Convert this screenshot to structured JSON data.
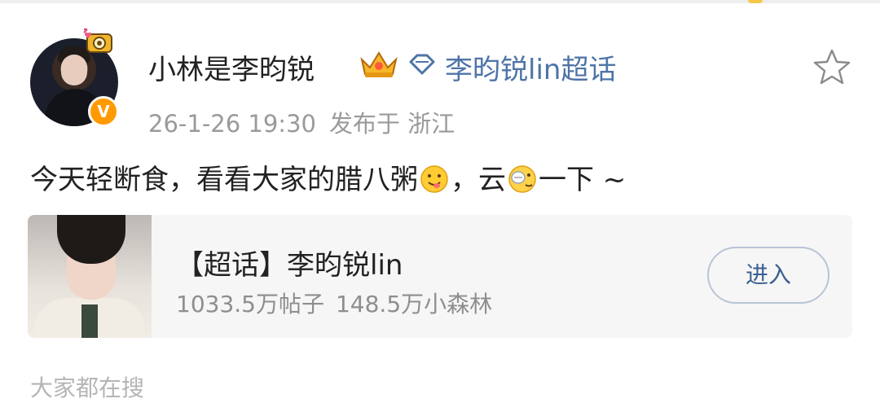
{
  "post": {
    "author": "小林是李昀锐",
    "topic_link": "李昀锐lin超话",
    "timestamp": "26-1-26 19:30",
    "location": "发布于 浙江",
    "text_part1": "今天轻断食，看看大家的腊八粥",
    "text_part2": "，云",
    "text_part3": "一下 ~"
  },
  "topic_card": {
    "title": "【超话】李昀锐lin",
    "posts_count": "1033.5万帖子",
    "members_count": "148.5万小森林",
    "enter_label": "进入"
  },
  "section_hint": "大家都在搜",
  "colors": {
    "link": "#4e74a8",
    "meta_text": "#9a9a9a",
    "badge_orange": "#ff9a00",
    "card_bg": "#f6f6f6"
  },
  "icons": [
    "camera-badge-icon",
    "verified-v-icon",
    "crown-icon",
    "diamond-icon",
    "star-icon",
    "yummy-face-emoji",
    "eating-face-emoji"
  ]
}
